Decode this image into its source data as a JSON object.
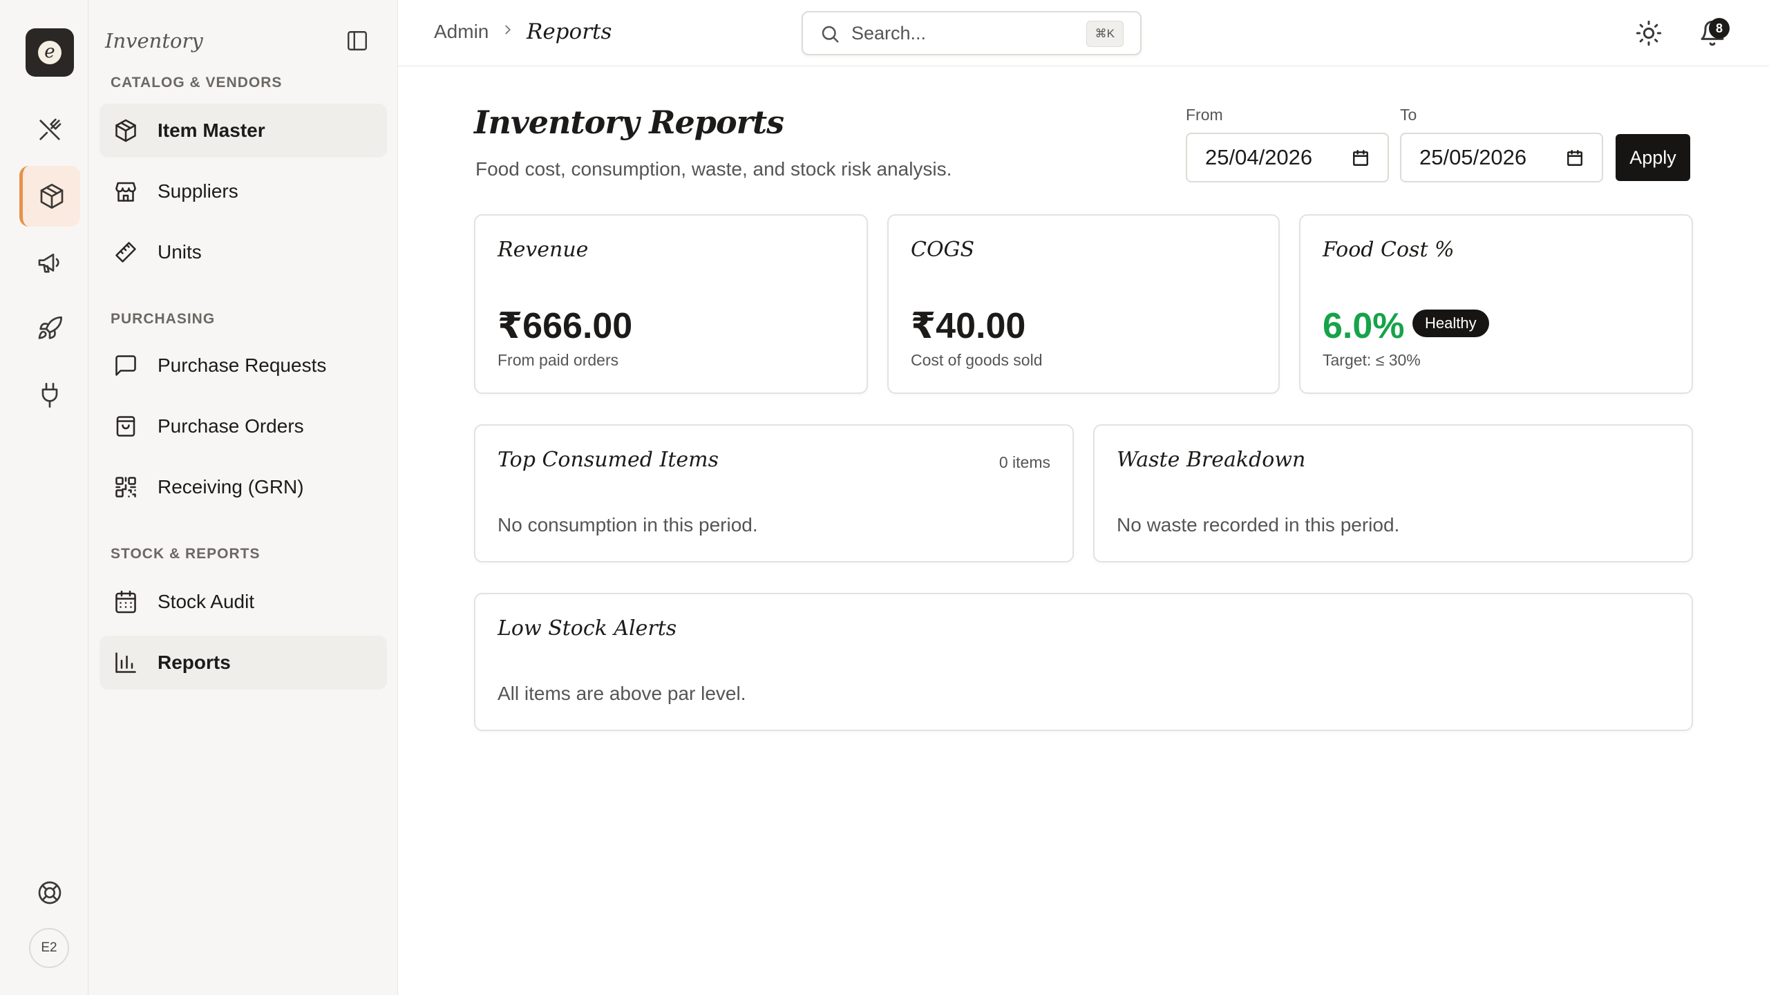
{
  "app": {
    "logo_letter": "e",
    "user_initials": "E2"
  },
  "rail": {
    "icons": [
      "utensils-icon",
      "box-icon",
      "megaphone-icon",
      "rocket-icon",
      "plug-icon",
      "lifebuoy-icon"
    ],
    "active": "box-icon"
  },
  "sidebar": {
    "title": "Inventory",
    "sections": [
      {
        "label": "CATALOG & VENDORS",
        "items": [
          {
            "label": "Item Master",
            "icon": "package-icon"
          },
          {
            "label": "Suppliers",
            "icon": "store-icon"
          },
          {
            "label": "Units",
            "icon": "ruler-icon"
          }
        ]
      },
      {
        "label": "PURCHASING",
        "items": [
          {
            "label": "Purchase Requests",
            "icon": "message-square-icon"
          },
          {
            "label": "Purchase Orders",
            "icon": "shopping-bag-icon"
          },
          {
            "label": "Receiving (GRN)",
            "icon": "qr-code-icon"
          }
        ]
      },
      {
        "label": "STOCK & REPORTS",
        "items": [
          {
            "label": "Stock Audit",
            "icon": "calendar-grid-icon"
          },
          {
            "label": "Reports",
            "icon": "bar-chart-icon"
          }
        ]
      }
    ],
    "active_item": "Reports"
  },
  "topbar": {
    "breadcrumb_root": "Admin",
    "breadcrumb_current": "Reports",
    "search_placeholder": "Search...",
    "search_shortcut": "⌘K",
    "notification_count": "8"
  },
  "page": {
    "title": "Inventory Reports",
    "subtitle": "Food cost, consumption, waste, and stock risk analysis."
  },
  "filters": {
    "from_label": "From",
    "from_value": "25/04/2026",
    "to_label": "To",
    "to_value": "25/05/2026",
    "apply_label": "Apply"
  },
  "stats": {
    "revenue": {
      "title": "Revenue",
      "value": "₹666.00",
      "caption": "From paid orders"
    },
    "cogs": {
      "title": "COGS",
      "value": "₹40.00",
      "caption": "Cost of goods sold"
    },
    "food_cost": {
      "title": "Food Cost %",
      "value": "6.0%",
      "badge": "Healthy",
      "caption": "Target: ≤ 30%",
      "value_color": "#16a34a"
    }
  },
  "panels": {
    "top_consumed": {
      "title": "Top Consumed Items",
      "count": "0 items",
      "empty": "No consumption in this period."
    },
    "waste": {
      "title": "Waste Breakdown",
      "empty": "No waste recorded in this period."
    },
    "low_stock": {
      "title": "Low Stock Alerts",
      "empty": "All items are above par level."
    }
  }
}
